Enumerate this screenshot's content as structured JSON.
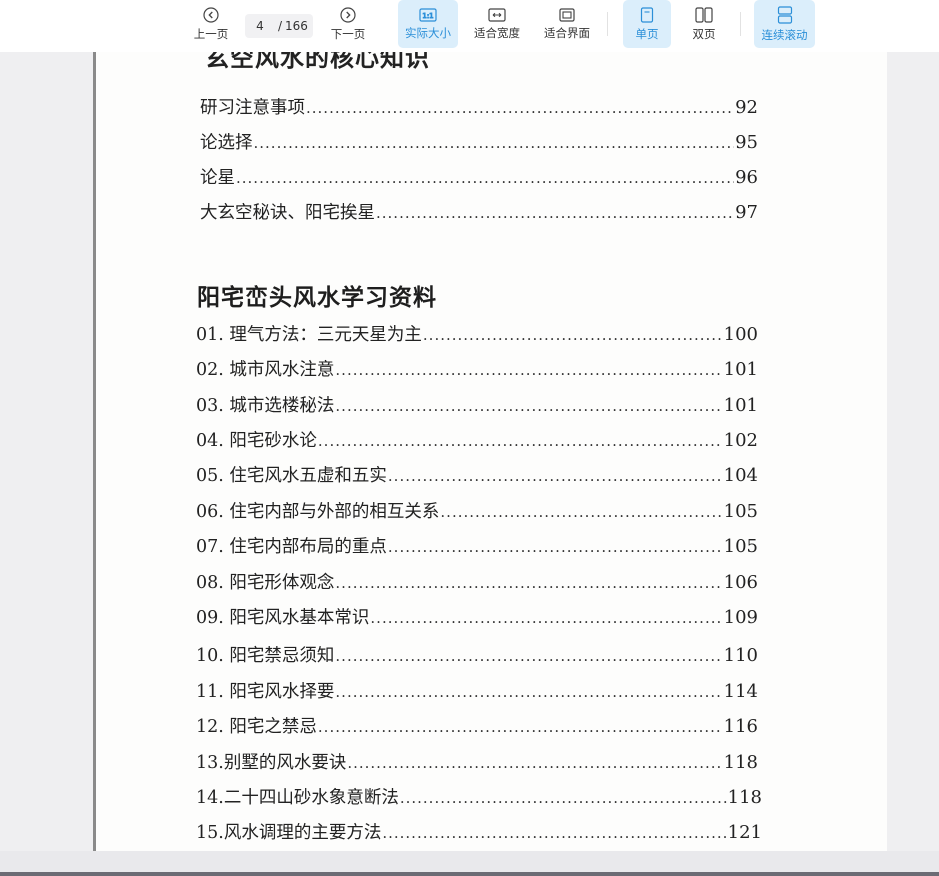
{
  "toolbar": {
    "prev_label": "上一页",
    "next_label": "下一页",
    "current_page": "4",
    "separator": "/",
    "total_pages": "166",
    "actual_size_label": "实际大小",
    "actual_size_icon_text": "1:1",
    "fit_width_label": "适合宽度",
    "fit_page_label": "适合界面",
    "single_page_label": "单页",
    "double_page_label": "双页",
    "continuous_label": "连续滚动",
    "active_accent": "#2b8fd8",
    "active_bg": "#dbeefb"
  },
  "document": {
    "cut_title": "玄空风水的核心知识",
    "section1": [
      {
        "title": "研习注意事项",
        "page": "92"
      },
      {
        "title": "论选择",
        "page": "95"
      },
      {
        "title": "论星",
        "page": "96"
      },
      {
        "title": "大玄空秘诀、阳宅挨星",
        "page": "97"
      }
    ],
    "section2_title": "阳宅峦头风水学习资料",
    "section2": [
      {
        "title": "01. 理气方法：三元天星为主",
        "page": "100"
      },
      {
        "title": "02. 城市风水注意",
        "page": "101"
      },
      {
        "title": "03. 城市选楼秘法",
        "page": "101"
      },
      {
        "title": "04. 阳宅砂水论",
        "page": "102"
      },
      {
        "title": "05. 住宅风水五虚和五实",
        "page": "104"
      },
      {
        "title": "06. 住宅内部与外部的相互关系",
        "page": "105"
      },
      {
        "title": "07. 住宅内部布局的重点",
        "page": "105"
      },
      {
        "title": "08. 阳宅形体观念",
        "page": "106"
      },
      {
        "title": "09. 阳宅风水基本常识",
        "page": "109"
      },
      {
        "title": "10. 阳宅禁忌须知",
        "page": "110"
      },
      {
        "title": "11. 阳宅风水择要",
        "page": "114"
      },
      {
        "title": "12. 阳宅之禁忌",
        "page": "116"
      },
      {
        "title": "13.别墅的风水要诀",
        "page": "118"
      },
      {
        "title": "14.二十四山砂水象意断法",
        "page": "118"
      },
      {
        "title": "15.风水调理的主要方法",
        "page": "121"
      }
    ]
  }
}
